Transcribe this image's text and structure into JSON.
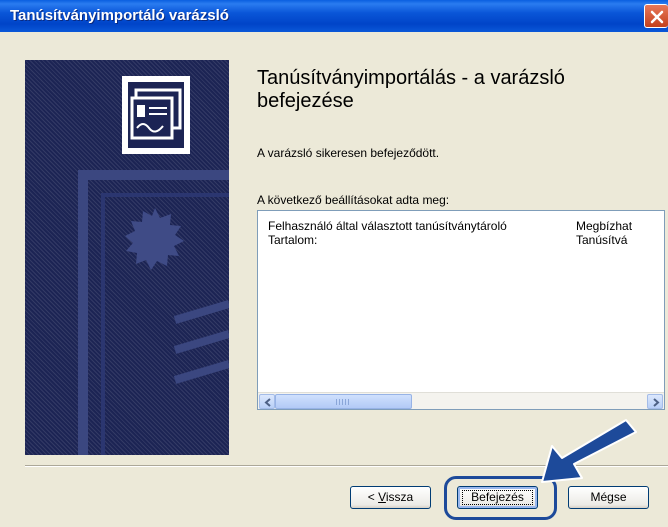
{
  "window": {
    "title": "Tanúsítványimportáló varázsló",
    "close_icon": "close-icon"
  },
  "wizard": {
    "heading": "Tanúsítványimportálás - a varázsló befejezése",
    "success_message": "A varázsló sikeresen befejeződött.",
    "settings_label": "A következő beállításokat adta meg:",
    "settings_rows": [
      {
        "name": "Felhasználó által választott tanúsítványtároló",
        "value": "Megbízhat"
      },
      {
        "name": "Tartalom:",
        "value": "Tanúsítvá"
      }
    ]
  },
  "buttons": {
    "back_prefix": "< ",
    "back_accel": "V",
    "back_rest": "issza",
    "finish": "Befejezés",
    "cancel": "Mégse"
  },
  "colors": {
    "titlebar": "#0a56d8",
    "dialog_bg": "#ece9d8",
    "sidepanel": "#1c2454",
    "annotation": "#1d4a9a"
  }
}
